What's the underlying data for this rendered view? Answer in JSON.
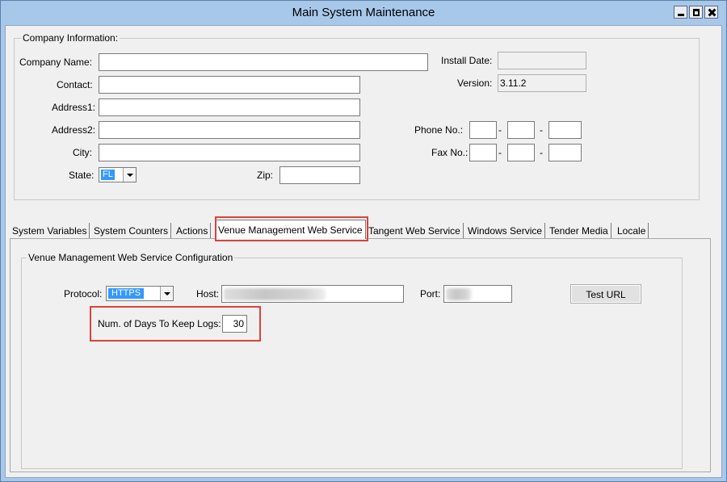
{
  "window": {
    "title": "Main System Maintenance",
    "controls": [
      "minimize-icon",
      "maximize-icon",
      "close-icon"
    ]
  },
  "company_info": {
    "group_title": "Company Information:",
    "company_name_label": "Company Name:",
    "company_name_value": "",
    "contact_label": "Contact:",
    "contact_value": "",
    "address1_label": "Address1:",
    "address1_value": "",
    "address2_label": "Address2:",
    "address2_value": "",
    "city_label": "City:",
    "city_value": "",
    "state_label": "State:",
    "state_value": "FL",
    "zip_label": "Zip:",
    "zip_value": "",
    "install_date_label": "Install Date:",
    "install_date_value": "",
    "version_label": "Version:",
    "version_value": "3.11.2",
    "phone_label": "Phone No.:",
    "fax_label": "Fax No.:",
    "separator": "-"
  },
  "tabs": [
    {
      "label": "System Variables",
      "active": false
    },
    {
      "label": "System Counters",
      "active": false
    },
    {
      "label": "Actions",
      "active": false
    },
    {
      "label": "Venue Management Web Service",
      "active": true
    },
    {
      "label": "Tangent Web Service",
      "active": false
    },
    {
      "label": "Windows Service",
      "active": false
    },
    {
      "label": "Tender Media",
      "active": false
    },
    {
      "label": "Locale",
      "active": false
    }
  ],
  "vmws_config": {
    "group_title": "Venue Management Web Service Configuration",
    "protocol_label": "Protocol:",
    "protocol_value": "HTTPS",
    "host_label": "Host:",
    "port_label": "Port:",
    "test_url_label": "Test URL",
    "days_label": "Num. of Days To Keep Logs:",
    "days_value": "30"
  },
  "colors": {
    "highlight": "#d9433a",
    "selection": "#3399ff",
    "window_frame": "#a8c8ea"
  }
}
